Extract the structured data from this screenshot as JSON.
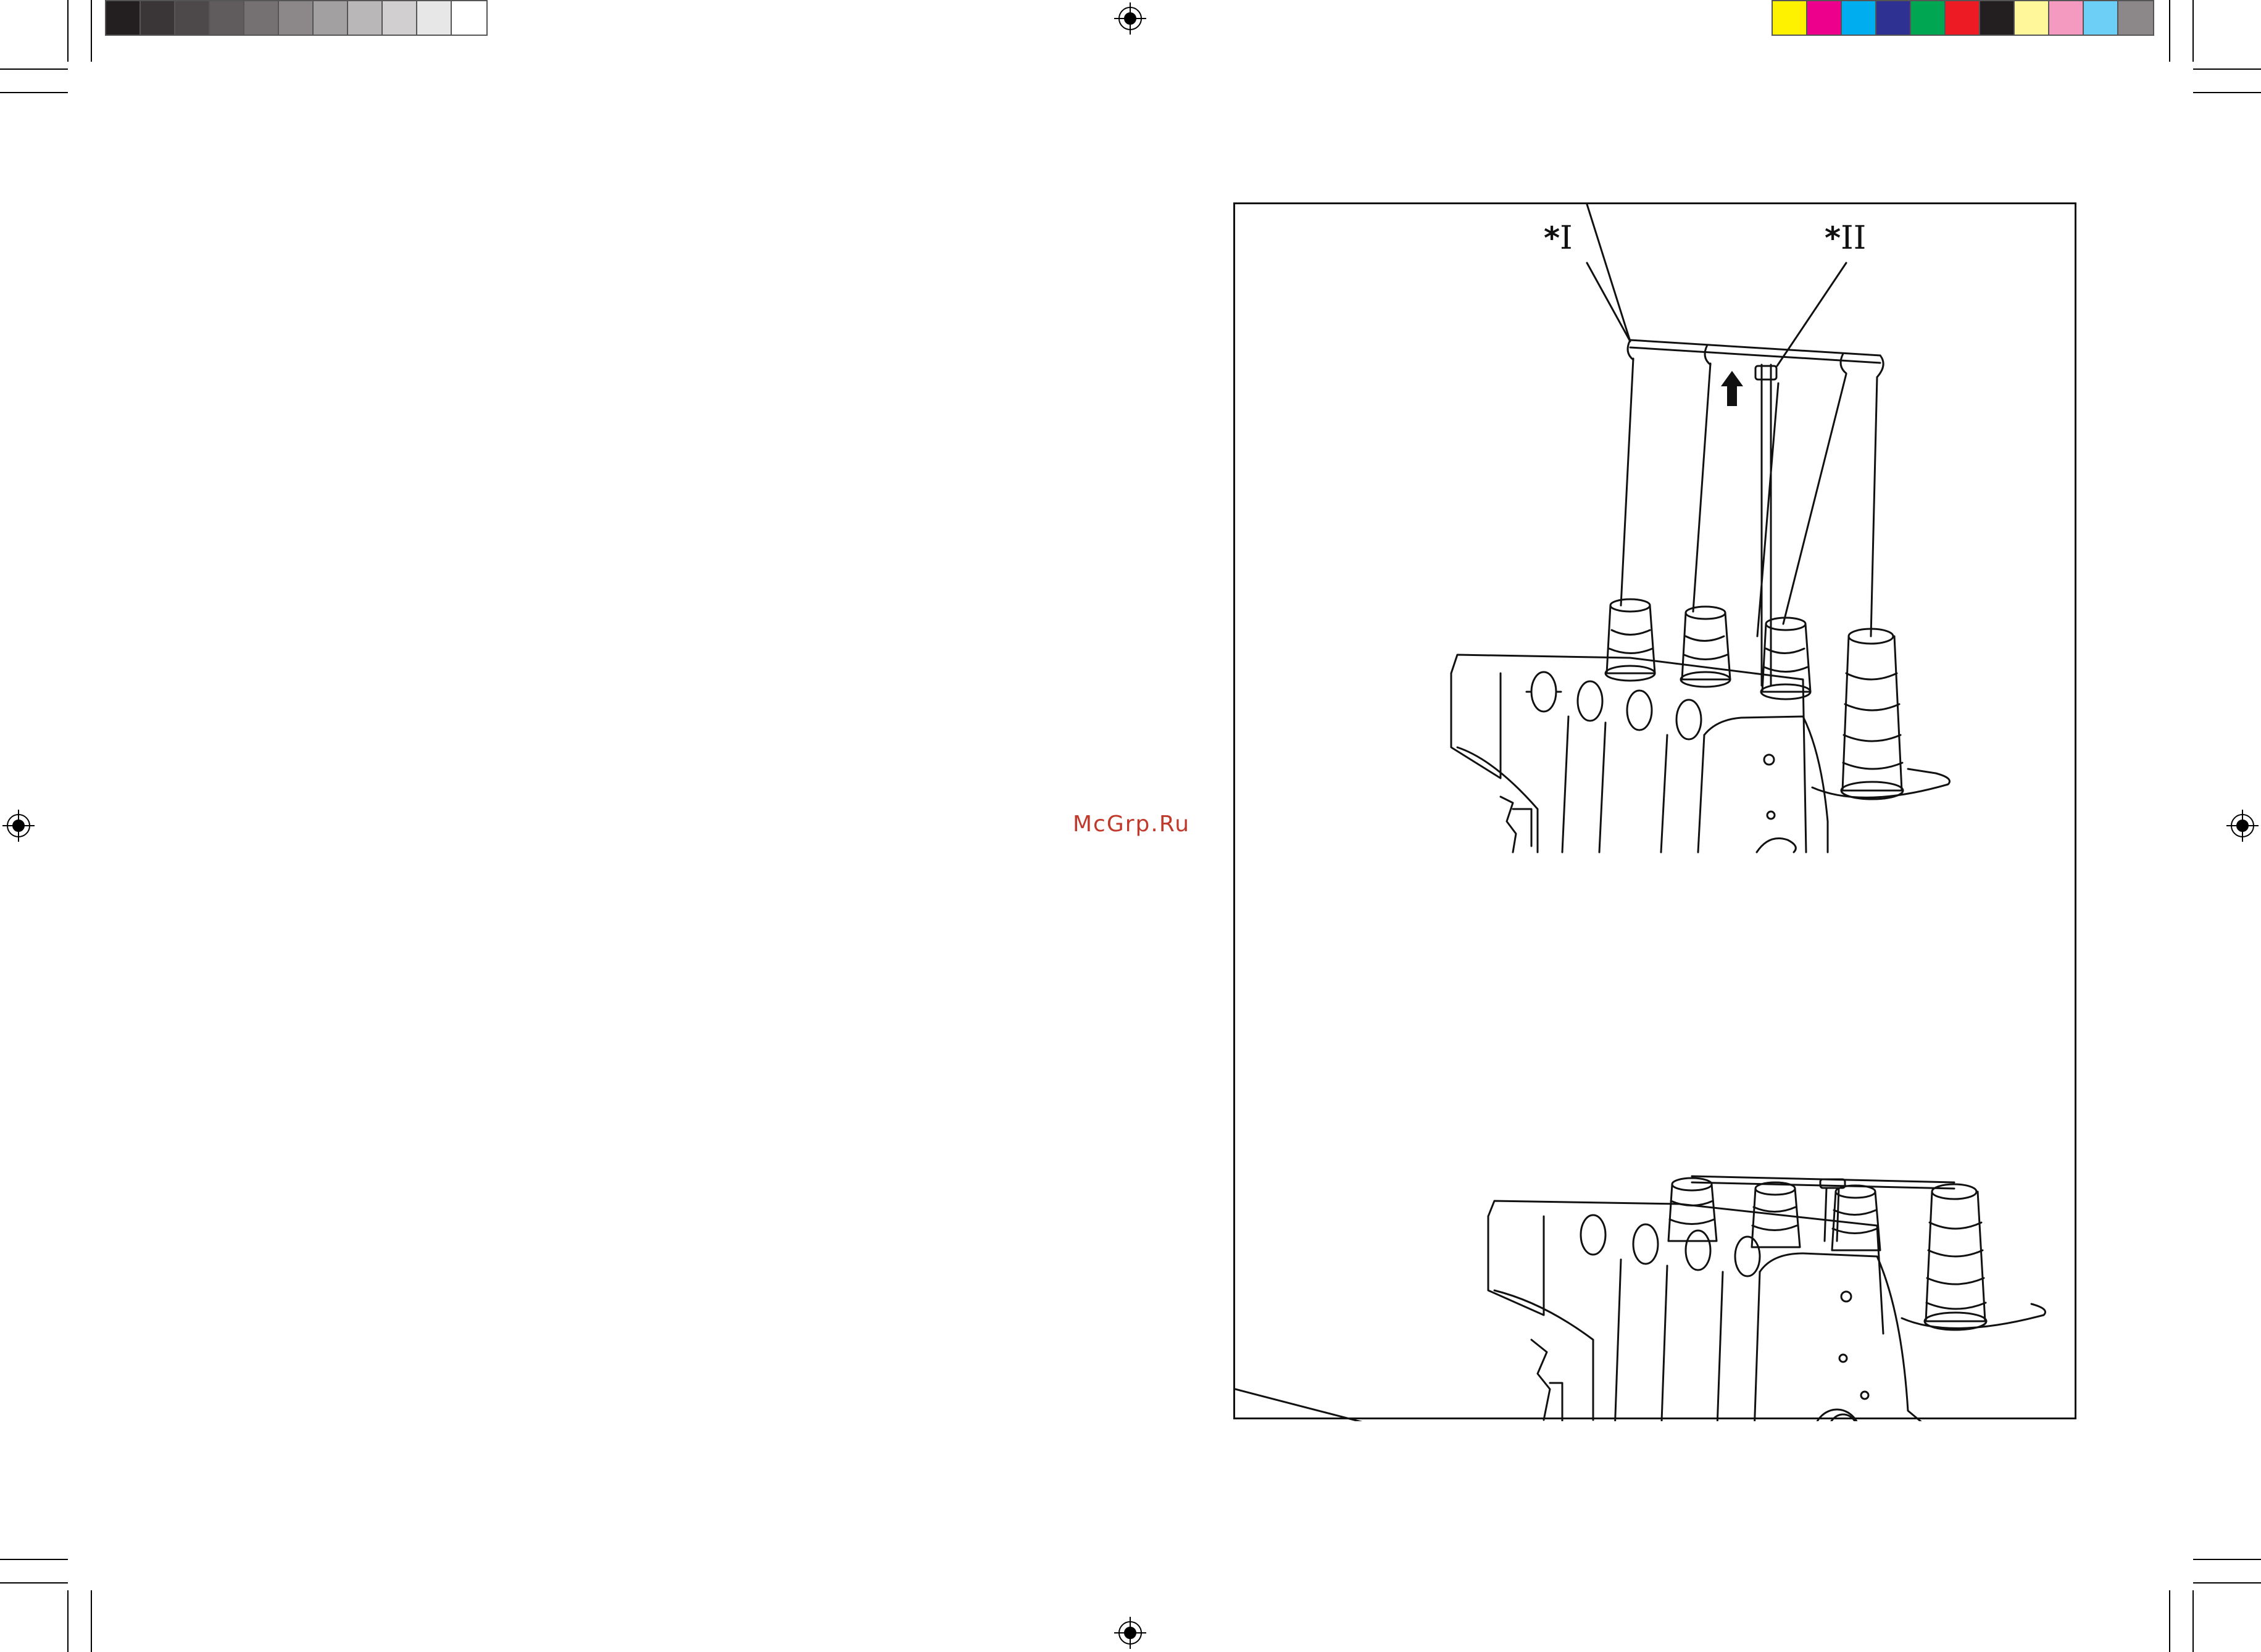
{
  "watermark": {
    "text": "McGrp.Ru"
  },
  "callouts": {
    "label_1": "I",
    "label_2": "II",
    "marker": "*"
  },
  "grayscale_bar": [
    "#231f20",
    "#3a3637",
    "#4d494a",
    "#605c5d",
    "#757172",
    "#8c8889",
    "#a3a0a1",
    "#bab7b8",
    "#d1cfd0",
    "#e8e7e7",
    "#ffffff"
  ],
  "color_bar": [
    "#fff200",
    "#ec008c",
    "#00aeef",
    "#2e3192",
    "#00a651",
    "#ed1c24",
    "#231f20",
    "#fff799",
    "#f49ac1",
    "#6dcff6",
    "#8c8889"
  ],
  "icons": {
    "registration_marks": "registration-crosshair-icon",
    "up_arrow": "up-arrow-icon"
  }
}
